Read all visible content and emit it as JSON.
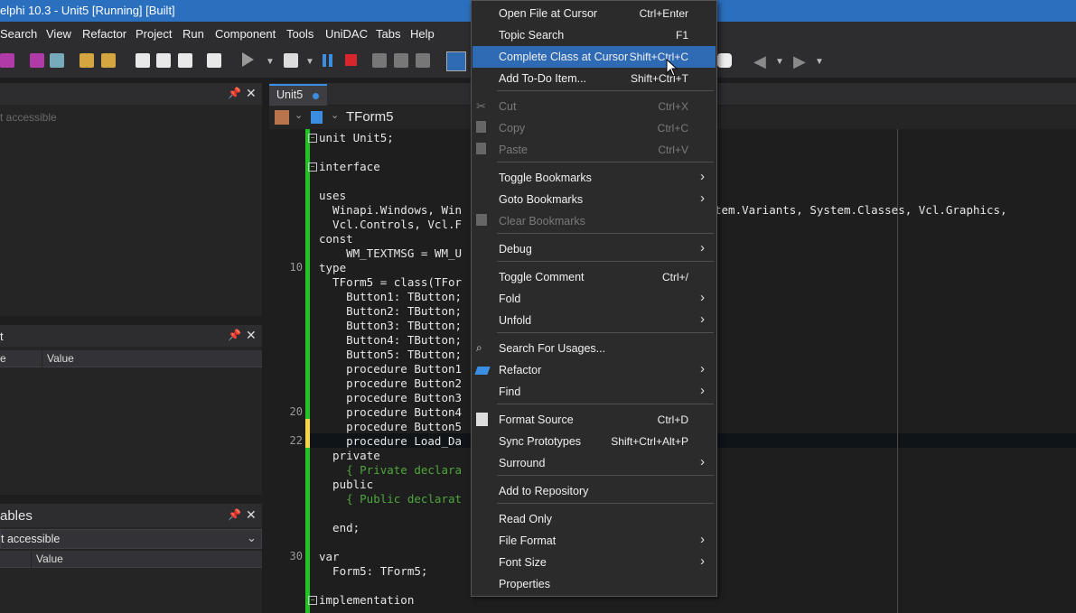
{
  "window": {
    "title": "elphi 10.3 - Unit5 [Running] [Built]"
  },
  "menubar": {
    "items": [
      "Search",
      "View",
      "Refactor",
      "Project",
      "Run",
      "Component",
      "Tools",
      "UniDAC",
      "Tabs",
      "Help"
    ]
  },
  "panels": {
    "top": {
      "hint": "t accessible"
    },
    "middle": {
      "col1": "e",
      "col2": "Value",
      "title": "t"
    },
    "bottom": {
      "title": "ables",
      "dropdown": "t accessible",
      "col2": "Value"
    }
  },
  "editor": {
    "tab": "Unit5",
    "breadcrumb": "TForm5",
    "line_numbers": {
      "l10": "10",
      "l20": "20",
      "l22": "22",
      "l30": "30"
    },
    "lines": [
      "unit Unit5;",
      "",
      "interface",
      "",
      "uses",
      "  Winapi.Windows, Win",
      "  Vcl.Controls, Vcl.F",
      "const",
      "    WM_TEXTMSG = WM_U",
      "type",
      "  TForm5 = class(TFor",
      "    Button1: TButton;",
      "    Button2: TButton;",
      "    Button3: TButton;",
      "    Button4: TButton;",
      "    Button5: TButton;",
      "    procedure Button1",
      "    procedure Button2",
      "    procedure Button3",
      "    procedure Button4",
      "    procedure Button5",
      "    procedure Load_Da",
      "  private",
      "    { Private declara",
      "  public",
      "    { Public declarat",
      "",
      "  end;",
      "",
      "var",
      "  Form5: TForm5;",
      "",
      "implementation"
    ],
    "hidden_tail": "tem.Variants, System.Classes, Vcl.Graphics,"
  },
  "context_menu": {
    "items": [
      {
        "label": "Open File at Cursor",
        "shortcut": "Ctrl+Enter"
      },
      {
        "label": "Topic Search",
        "shortcut": "F1"
      },
      {
        "label": "Complete Class at Cursor",
        "shortcut": "Shift+Ctrl+C"
      },
      {
        "label": "Add To-Do Item...",
        "shortcut": "Shift+Ctrl+T"
      },
      {
        "label": "Cut",
        "shortcut": "Ctrl+X"
      },
      {
        "label": "Copy",
        "shortcut": "Ctrl+C"
      },
      {
        "label": "Paste",
        "shortcut": "Ctrl+V"
      },
      {
        "label": "Toggle Bookmarks",
        "shortcut": ""
      },
      {
        "label": "Goto Bookmarks",
        "shortcut": ""
      },
      {
        "label": "Clear Bookmarks",
        "shortcut": ""
      },
      {
        "label": "Debug",
        "shortcut": ""
      },
      {
        "label": "Toggle Comment",
        "shortcut": "Ctrl+/"
      },
      {
        "label": "Fold",
        "shortcut": ""
      },
      {
        "label": "Unfold",
        "shortcut": ""
      },
      {
        "label": "Search For Usages...",
        "shortcut": ""
      },
      {
        "label": "Refactor",
        "shortcut": ""
      },
      {
        "label": "Find",
        "shortcut": ""
      },
      {
        "label": "Format Source",
        "shortcut": "Ctrl+D"
      },
      {
        "label": "Sync Prototypes",
        "shortcut": "Shift+Ctrl+Alt+P"
      },
      {
        "label": "Surround",
        "shortcut": ""
      },
      {
        "label": "Add to Repository",
        "shortcut": ""
      },
      {
        "label": "Read Only",
        "shortcut": ""
      },
      {
        "label": "File Format",
        "shortcut": ""
      },
      {
        "label": "Font Size",
        "shortcut": ""
      },
      {
        "label": "Properties",
        "shortcut": ""
      }
    ]
  },
  "colors": {
    "accent": "#2f6bb5",
    "title_bar": "#2b6fbf",
    "green_gutter": "#21c521",
    "modified_gutter": "#f5d547",
    "keyword": "#c8c8c8",
    "comment": "#4fa63c",
    "string": "#d0d0d0"
  }
}
